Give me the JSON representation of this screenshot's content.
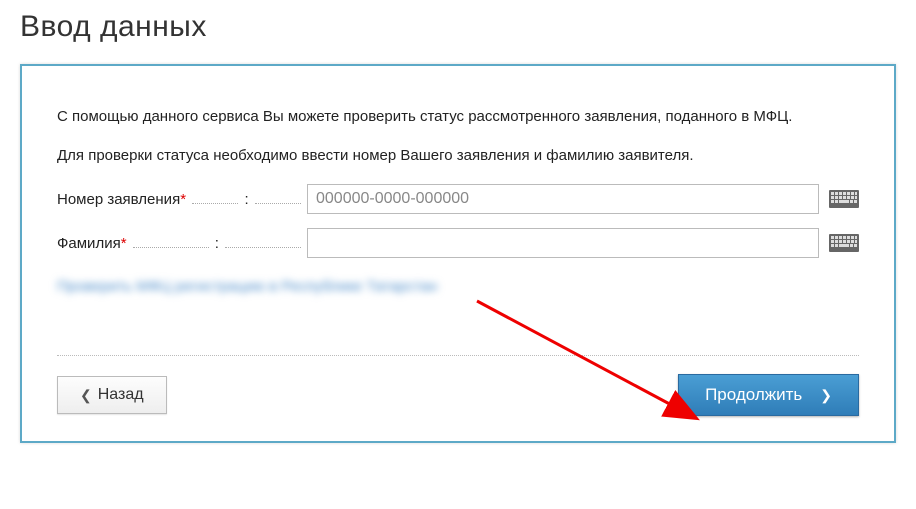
{
  "page": {
    "title": "Ввод данных"
  },
  "panel": {
    "intro1": "С помощью данного сервиса Вы можете проверить статус рассмотренного заявления, поданного в МФЦ.",
    "intro2": "Для проверки статуса необходимо ввести номер Вашего заявления и фамилию заявителя."
  },
  "form": {
    "app_number": {
      "label": "Номер заявления",
      "placeholder": "000000-0000-000000",
      "value": ""
    },
    "surname": {
      "label": "Фамилия",
      "placeholder": "",
      "value": ""
    }
  },
  "blurred_text": "Проверить МФЦ регистрацию в Республике Татарстан",
  "buttons": {
    "back": "Назад",
    "continue": "Продолжить"
  },
  "colors": {
    "panel_border": "#5da9c7",
    "primary_btn_top": "#4a9ed4",
    "primary_btn_bottom": "#2f7db8",
    "required": "#d00"
  }
}
